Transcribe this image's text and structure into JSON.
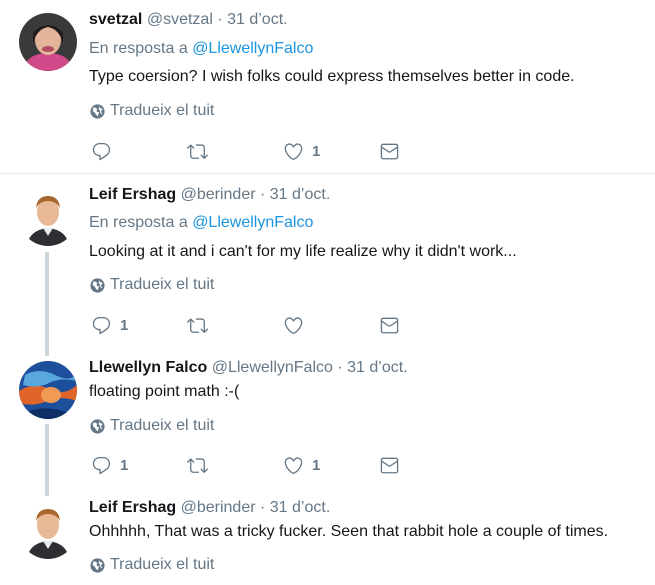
{
  "tweets": [
    {
      "name": "svetzal",
      "handle": "@svetzal",
      "dot": "·",
      "date": "31 d’oct.",
      "reply_prefix": "En resposta a",
      "reply_to": "@LlewellynFalco",
      "text": "Type coersion? I wish folks could express themselves better in code.",
      "translate": "Tradueix el tuit",
      "replies": "",
      "retweets": "",
      "likes": "1"
    },
    {
      "name": "Leif Ershag",
      "handle": "@berinder",
      "dot": "·",
      "date": "31 d’oct.",
      "reply_prefix": "En resposta a",
      "reply_to": "@LlewellynFalco",
      "text": "Looking at it and i can't for my life realize why it didn't work...",
      "translate": "Tradueix el tuit",
      "replies": "1",
      "retweets": "",
      "likes": ""
    },
    {
      "name": "Llewellyn Falco",
      "handle": "@LlewellynFalco",
      "dot": "·",
      "date": "31 d’oct.",
      "text": "floating point math :-(",
      "translate": "Tradueix el tuit",
      "replies": "1",
      "retweets": "",
      "likes": "1"
    },
    {
      "name": "Leif Ershag",
      "handle": "@berinder",
      "dot": "·",
      "date": "31 d’oct.",
      "text": "Ohhhhh, That was a tricky fucker. Seen that rabbit hole a couple of times.",
      "translate": "Tradueix el tuit"
    }
  ],
  "icons": {
    "reply": "reply-icon",
    "retweet": "retweet-icon",
    "like": "heart-icon",
    "dm": "envelope-icon",
    "translate": "globe-icon"
  },
  "colors": {
    "link": "#1b95e0",
    "muted": "#657786",
    "thread_line": "#ccd6dd"
  }
}
